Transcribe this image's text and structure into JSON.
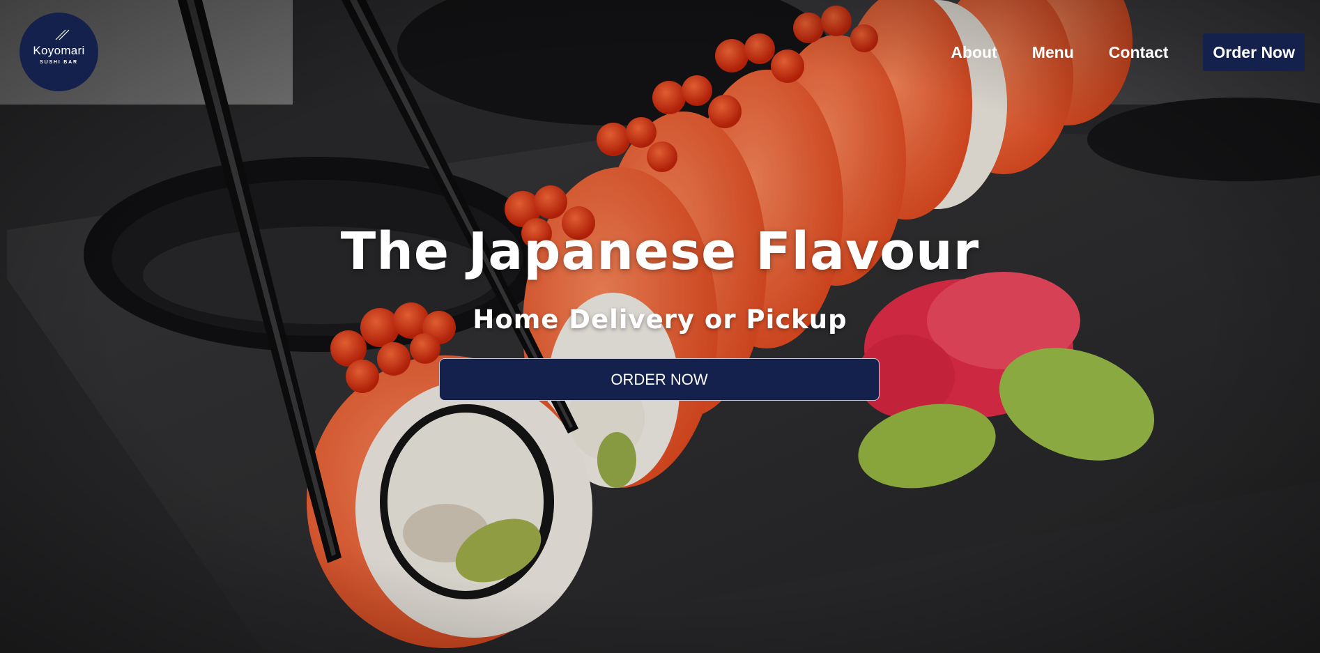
{
  "brand": {
    "name": "Koyomari",
    "tagline": "SUSHI BAR"
  },
  "nav": {
    "links": [
      {
        "label": "About"
      },
      {
        "label": "Menu"
      },
      {
        "label": "Contact"
      }
    ],
    "cta_label": "Order Now"
  },
  "hero": {
    "title": "The Japanese Flavour",
    "subtitle": "Home Delivery or Pickup",
    "cta_label": "ORDER NOW",
    "background_description_icon": "sushi-rolls-photo"
  },
  "colors": {
    "brand_navy": "#14214d",
    "text": "#ffffff"
  }
}
